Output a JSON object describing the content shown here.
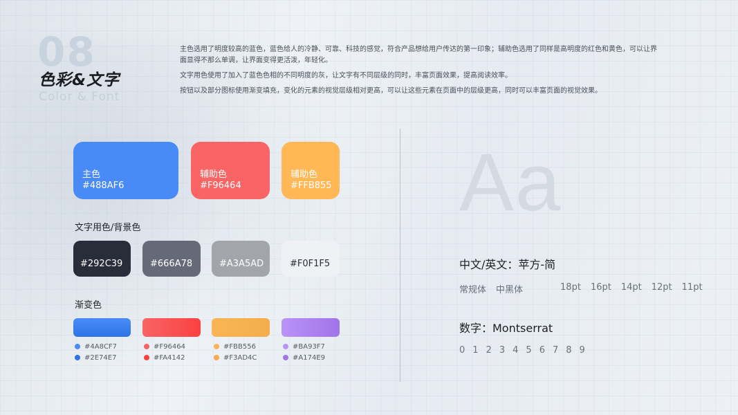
{
  "header": {
    "number": "08",
    "title_cn": "色彩&文字",
    "title_en": "Color & Font"
  },
  "intro": {
    "p1": "主色选用了明度较高的蓝色，蓝色给人的冷静、可靠、科技的感觉，符合产品想给用户传达的第一印象；辅助色选用了同样是高明度的红色和黄色，可以让界面显得不那么单调，让界面变得更活泼，年轻化。",
    "p2": "文字用色使用了加入了蓝色色相的不同明度的灰，让文字有不同层级的同时，丰富页面效果，提高阅读效率。",
    "p3": "按钮以及部分图标使用渐变填充，变化的元素的视觉层级相对更高，可以让这些元素在页面中的层级更高，同时可以丰富页面的视觉效果。"
  },
  "main_colors": [
    {
      "name": "主色",
      "hex": "#488AF6",
      "color": "#488AF6"
    },
    {
      "name": "辅助色",
      "hex": "#F96464",
      "color": "#F96464"
    },
    {
      "name": "辅助色",
      "hex": "#FFB855",
      "color": "#FFB855"
    }
  ],
  "text_colors": {
    "title": "文字用色/背景色",
    "items": [
      {
        "hex": "#292C39",
        "color": "#292C39"
      },
      {
        "hex": "#666A78",
        "color": "#666A78"
      },
      {
        "hex": "#A3A5AD",
        "color": "#A3A5AD"
      },
      {
        "hex": "#F0F1F5",
        "color": "#F0F1F5"
      }
    ]
  },
  "gradients": {
    "title": "渐变色",
    "items": [
      {
        "from": "#4A8CF7",
        "to": "#2E74E7"
      },
      {
        "from": "#F96464",
        "to": "#FA4142"
      },
      {
        "from": "#FBB556",
        "to": "#F3AD4C"
      },
      {
        "from": "#BA93F7",
        "to": "#A174E9"
      }
    ]
  },
  "fonts": {
    "aa": "Aa",
    "cn_title": "中文/英文：苹方-简",
    "styles": [
      "常规体",
      "中黑体"
    ],
    "sizes": [
      "18pt",
      "16pt",
      "14pt",
      "12pt",
      "11pt"
    ],
    "num_title": "数字：Montserrat",
    "digits": [
      "0",
      "1",
      "2",
      "3",
      "4",
      "5",
      "6",
      "7",
      "8",
      "9"
    ]
  }
}
